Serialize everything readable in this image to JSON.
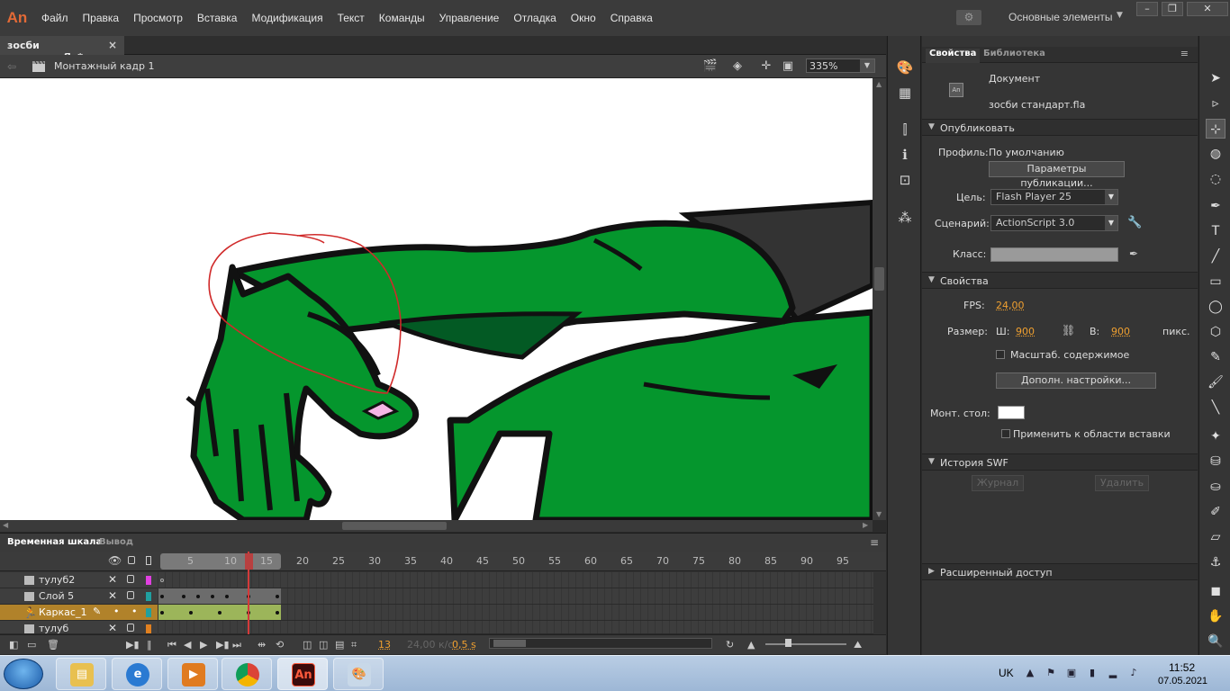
{
  "app": {
    "logo": "An",
    "menu": [
      "Файл",
      "Правка",
      "Просмотр",
      "Вставка",
      "Модификация",
      "Текст",
      "Команды",
      "Управление",
      "Отладка",
      "Окно",
      "Справка"
    ],
    "workspace": "Основные элементы",
    "window_buttons": [
      "–",
      "❐",
      "✕"
    ]
  },
  "document": {
    "tab_title": "зосби стандарт.fla*",
    "scene_label": "Монтажный кадр 1",
    "zoom": "335%"
  },
  "timeline": {
    "tabs": [
      "Временная шкала",
      "Вывод"
    ],
    "ruler": [
      "5",
      "10",
      "15",
      "20",
      "25",
      "30",
      "35",
      "40",
      "45",
      "50",
      "55",
      "60",
      "65",
      "70",
      "75",
      "80",
      "85",
      "90",
      "95"
    ],
    "layers": [
      {
        "name": "тулуб2",
        "color": "#e040e0"
      },
      {
        "name": "Слой 5",
        "color": "#20a0a0"
      },
      {
        "name": "Каркас_1",
        "color": "#20a0a0",
        "active": true
      },
      {
        "name": "тулуб",
        "color": "#e08020"
      }
    ],
    "current_frame": "13",
    "fps": "24,00 к/с",
    "time": "0,5 s"
  },
  "properties": {
    "tabs": [
      "Свойства",
      "Библиотека"
    ],
    "doc_type": "Документ",
    "doc_name": "зосби стандарт.fla",
    "doc_icon": "An",
    "publish_section": "Опубликовать",
    "profile_label": "Профиль:",
    "profile_value": "По умолчанию",
    "publish_settings_btn": "Параметры публикации...",
    "target_label": "Цель:",
    "target_value": "Flash Player 25",
    "script_label": "Сценарий:",
    "script_value": "ActionScript 3.0",
    "class_label": "Класс:",
    "props_section": "Свойства",
    "fps_label": "FPS:",
    "fps_value": "24,00",
    "size_label": "Размер:",
    "width_label": "Ш:",
    "width_value": "900",
    "height_label": "В:",
    "height_value": "900",
    "unit": "пикс.",
    "scale_content": "Масштаб. содержимое",
    "advanced_btn": "Дополн. настройки...",
    "stage_label": "Монт. стол:",
    "stage_color": "#ffffff",
    "apply_paste": "Применить к области вставки",
    "swf_history": "История SWF",
    "journal_btn": "Журнал",
    "delete_btn": "Удалить",
    "extended_access": "Расширенный доступ"
  },
  "taskbar": {
    "lang": "UK",
    "time": "11:52",
    "date": "07.05.2021"
  },
  "colors": {
    "limb_green": "#05962d",
    "shadow_green": "#035a24",
    "outline": "#111111",
    "stroke_red": "#d02a2a",
    "accent": "#f0a030"
  }
}
